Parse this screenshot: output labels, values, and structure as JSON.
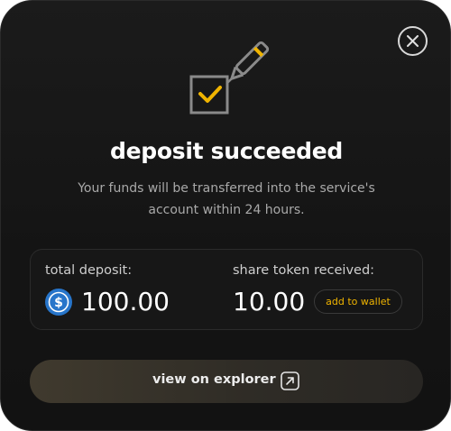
{
  "modal": {
    "title": "deposit succeeded",
    "subtitle": "Your funds will be transferred into the service's account within 24 hours.",
    "close_icon": "close-icon",
    "hero_icon": "checkbox-pen-icon"
  },
  "summary": {
    "total_deposit_label": "total deposit:",
    "total_deposit_value": "100.00",
    "token_icon": "usdc-icon",
    "share_token_label": "share token received:",
    "share_token_value": "10.00",
    "add_to_wallet_label": "add  to wallet"
  },
  "actions": {
    "view_explorer_label": "view on explorer",
    "external_icon": "external-link-icon"
  },
  "colors": {
    "accent": "#f0b400",
    "background": "#161616",
    "usdc": "#2775ca"
  }
}
